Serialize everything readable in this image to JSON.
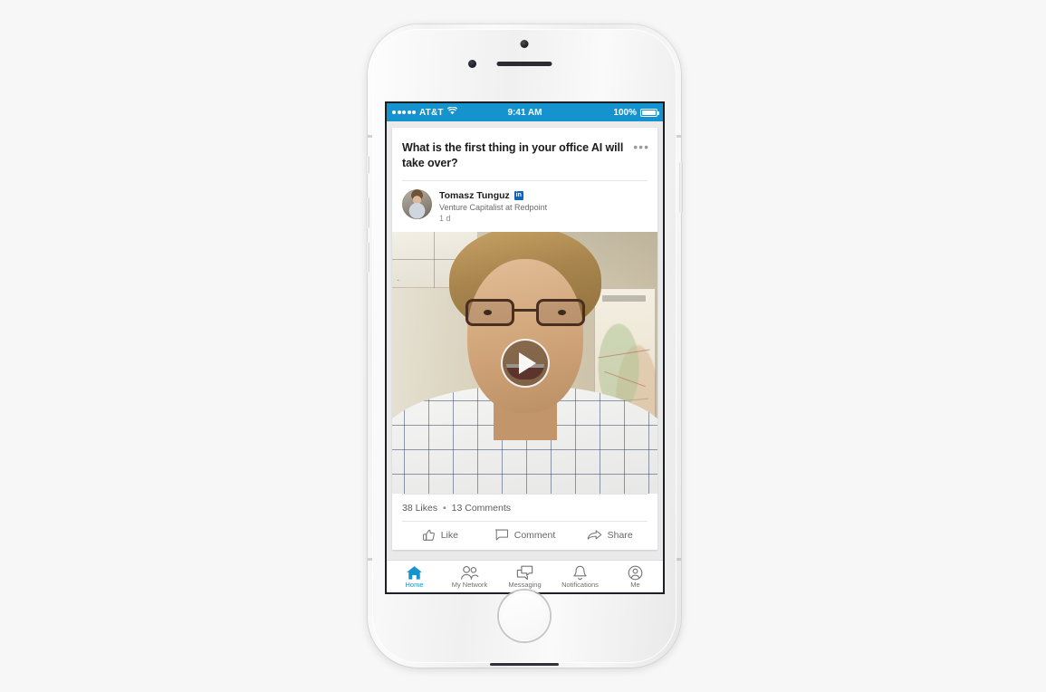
{
  "device": {
    "name": "iphone-mockup",
    "frame_color": "#f2f2f2"
  },
  "statusbar": {
    "carrier": "AT&T",
    "signal_dots": 5,
    "wifi_icon": "wifi-icon",
    "time": "9:41 AM",
    "battery_percent": "100%",
    "battery_icon": "battery-full-icon",
    "background": "#1593cf",
    "foreground": "#ffffff"
  },
  "post": {
    "title": "What is the first thing in your office AI will take over?",
    "more_label": "•••",
    "author": {
      "name": "Tomasz Tunguz",
      "badge_icon": "linkedin-badge-icon",
      "badge_text": "in",
      "headline": "Venture Capitalist at Redpoint",
      "time": "1 d",
      "avatar_icon": "avatar"
    },
    "video": {
      "play_icon": "play-icon",
      "alt": "video-thumbnail"
    },
    "counts": {
      "likes": "38 Likes",
      "separator": "•",
      "comments": "13 Comments"
    },
    "actions": [
      {
        "label": "Like",
        "icon": "thumbs-up-icon"
      },
      {
        "label": "Comment",
        "icon": "comment-bubble-icon"
      },
      {
        "label": "Share",
        "icon": "share-arrow-icon"
      }
    ]
  },
  "tabbar": {
    "active_color": "#1593cf",
    "inactive_color": "#6e6e6e",
    "items": [
      {
        "label": "Home",
        "icon": "home-icon",
        "active": true
      },
      {
        "label": "My Network",
        "icon": "people-icon",
        "active": false
      },
      {
        "label": "Messaging",
        "icon": "messaging-icon",
        "active": false
      },
      {
        "label": "Notifications",
        "icon": "bell-icon",
        "active": false
      },
      {
        "label": "Me",
        "icon": "person-circle-icon",
        "active": false
      }
    ]
  }
}
